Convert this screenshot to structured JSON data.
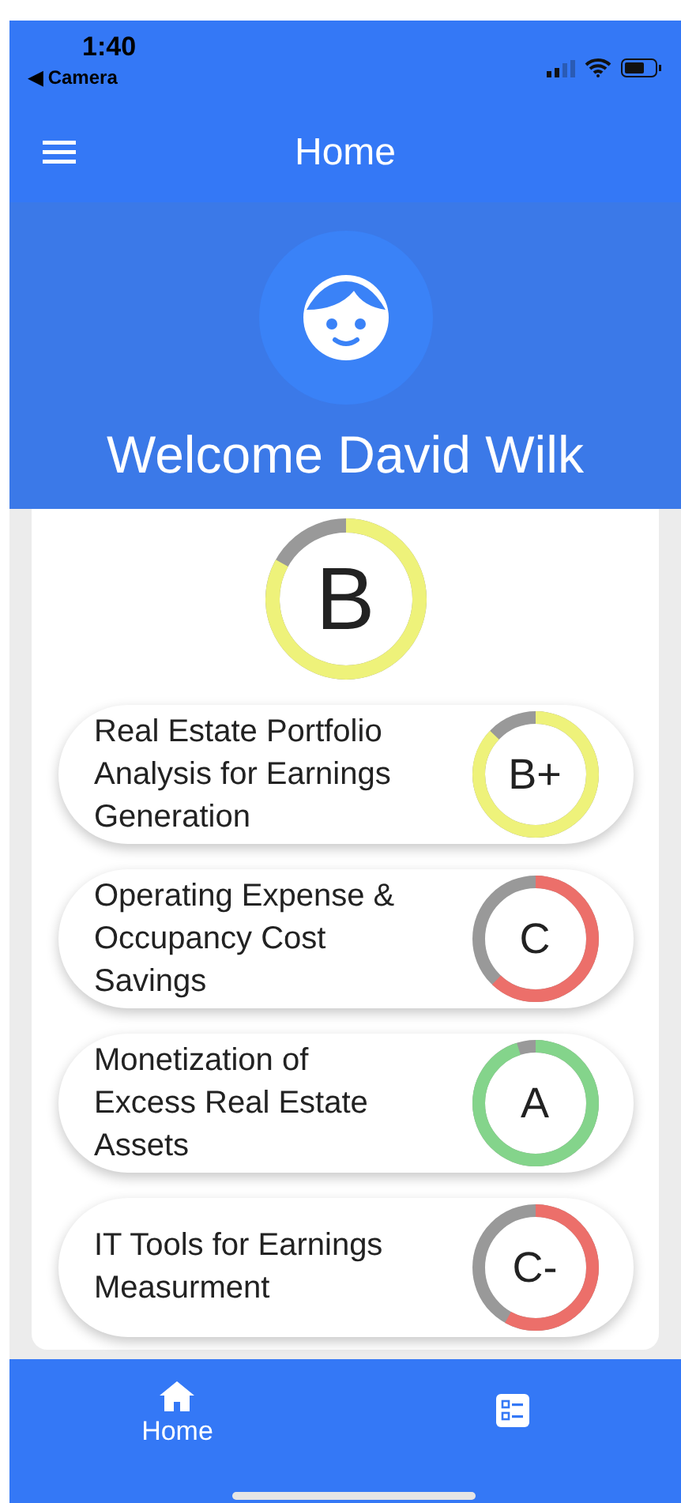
{
  "status_bar": {
    "time": "1:40",
    "back_label": "◀ Camera"
  },
  "app_bar": {
    "title": "Home"
  },
  "header": {
    "welcome": "Welcome David Wilk"
  },
  "overall": {
    "grade": "B",
    "color": "#eef27a"
  },
  "categories": [
    {
      "title": "Real Estate Portfolio Analysis for Earnings Generation",
      "grade": "B+",
      "color": "#eef27a"
    },
    {
      "title": "Operating Expense & Occupancy Cost Savings",
      "grade": "C",
      "color": "#ec6f6a"
    },
    {
      "title": "Monetization of Excess Real Estate Assets",
      "grade": "A",
      "color": "#84d48b"
    },
    {
      "title": "IT Tools for Earnings Measurment",
      "grade": "C-",
      "color": "#ec6f6a"
    }
  ],
  "bottom_nav": [
    {
      "kind": "home",
      "label": "Home"
    },
    {
      "kind": "list"
    }
  ]
}
